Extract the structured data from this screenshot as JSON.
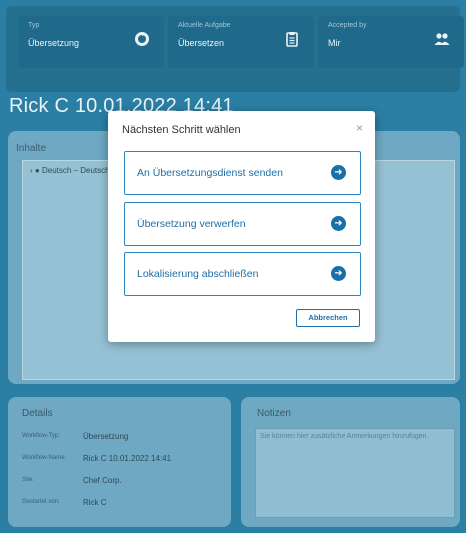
{
  "header": {
    "cards": [
      {
        "label": "Typ",
        "value": "Übersetzung",
        "icon": "refresh-icon"
      },
      {
        "label": "Aktuelle Aufgabe",
        "value": "Übersetzen",
        "icon": "clipboard-icon"
      },
      {
        "label": "Accepted by",
        "value": "Mir",
        "icon": "users-icon"
      }
    ]
  },
  "workflow": {
    "title": "Rick C 10.01.2022 14:41"
  },
  "content": {
    "title": "Inhalte",
    "tree_item": "Deutsch – Deutsch"
  },
  "details": {
    "title": "Details",
    "rows": [
      {
        "label": "Workflow-Typ:",
        "value": "Übersetzung"
      },
      {
        "label": "Workflow-Name:",
        "value": "Rick C 10.01.2022 14:41"
      },
      {
        "label": "Site:",
        "value": "Chef Corp."
      },
      {
        "label": "Gestartet von:",
        "value": "Rick C"
      }
    ]
  },
  "notes": {
    "title": "Notizen",
    "placeholder": "Sie können hier zusätzliche Anmerkungen hinzufügen."
  },
  "modal": {
    "title": "Nächsten Schritt wählen",
    "close": "×",
    "options": [
      {
        "label": "An Übersetzungsdienst senden"
      },
      {
        "label": "Übersetzung verwerfen"
      },
      {
        "label": "Lokalisierung abschließen"
      }
    ],
    "cancel": "Abbrechen"
  },
  "colors": {
    "background": "#2b7fa4",
    "accent": "#1f6ea6"
  }
}
